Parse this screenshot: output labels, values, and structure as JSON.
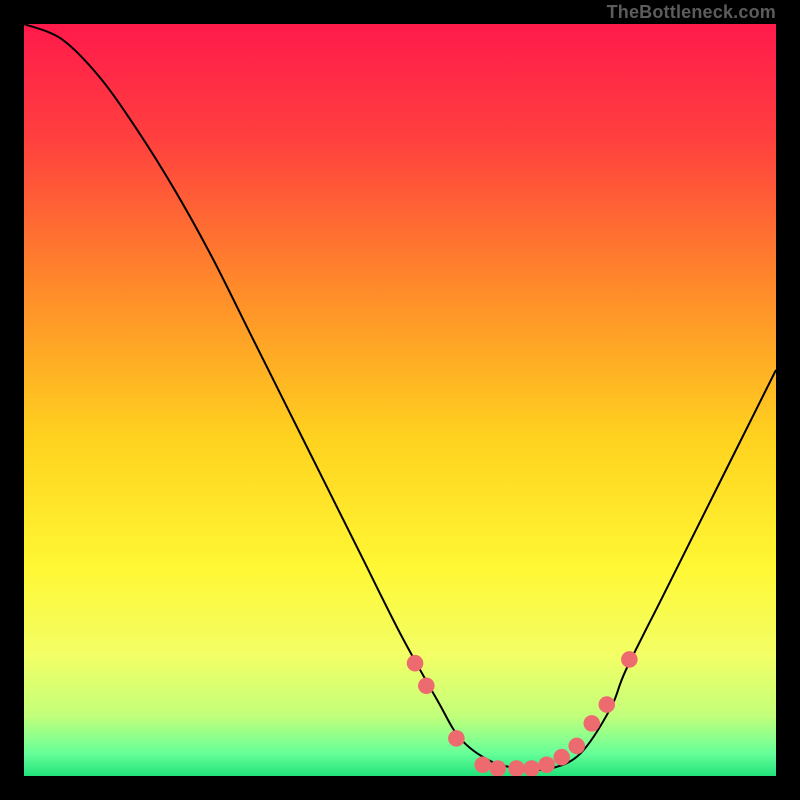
{
  "watermark": "TheBottleneck.com",
  "chart_data": {
    "type": "line",
    "title": "",
    "xlabel": "",
    "ylabel": "",
    "xlim": [
      0,
      100
    ],
    "ylim": [
      0,
      100
    ],
    "grid": false,
    "legend": false,
    "background_gradient": {
      "stops": [
        {
          "offset": 0.0,
          "color": "#ff1a4b"
        },
        {
          "offset": 0.15,
          "color": "#ff3f3f"
        },
        {
          "offset": 0.35,
          "color": "#ff8a2a"
        },
        {
          "offset": 0.55,
          "color": "#ffd21f"
        },
        {
          "offset": 0.72,
          "color": "#fff733"
        },
        {
          "offset": 0.84,
          "color": "#f3ff66"
        },
        {
          "offset": 0.92,
          "color": "#c2ff7a"
        },
        {
          "offset": 0.97,
          "color": "#66ff99"
        },
        {
          "offset": 1.0,
          "color": "#22e27a"
        }
      ]
    },
    "series": [
      {
        "name": "bottleneck-curve",
        "color": "#000000",
        "x": [
          0,
          5,
          10,
          15,
          20,
          25,
          30,
          35,
          40,
          45,
          50,
          55,
          58,
          62,
          66,
          70,
          74,
          78,
          80,
          85,
          90,
          95,
          100
        ],
        "y": [
          100,
          98,
          93,
          86,
          78,
          69,
          59,
          49,
          39,
          29,
          19,
          10,
          5,
          2,
          1,
          1,
          3,
          9,
          14,
          24,
          34,
          44,
          54
        ]
      }
    ],
    "markers": {
      "name": "highlight-dots",
      "color": "#ed6a6f",
      "radius_pct": 1.1,
      "points": [
        {
          "x": 52.0,
          "y": 15.0
        },
        {
          "x": 53.5,
          "y": 12.0
        },
        {
          "x": 57.5,
          "y": 5.0
        },
        {
          "x": 61.0,
          "y": 1.5
        },
        {
          "x": 63.0,
          "y": 1.0
        },
        {
          "x": 65.5,
          "y": 1.0
        },
        {
          "x": 67.5,
          "y": 1.0
        },
        {
          "x": 69.5,
          "y": 1.5
        },
        {
          "x": 71.5,
          "y": 2.5
        },
        {
          "x": 73.5,
          "y": 4.0
        },
        {
          "x": 75.5,
          "y": 7.0
        },
        {
          "x": 77.5,
          "y": 9.5
        },
        {
          "x": 80.5,
          "y": 15.5
        }
      ]
    }
  }
}
